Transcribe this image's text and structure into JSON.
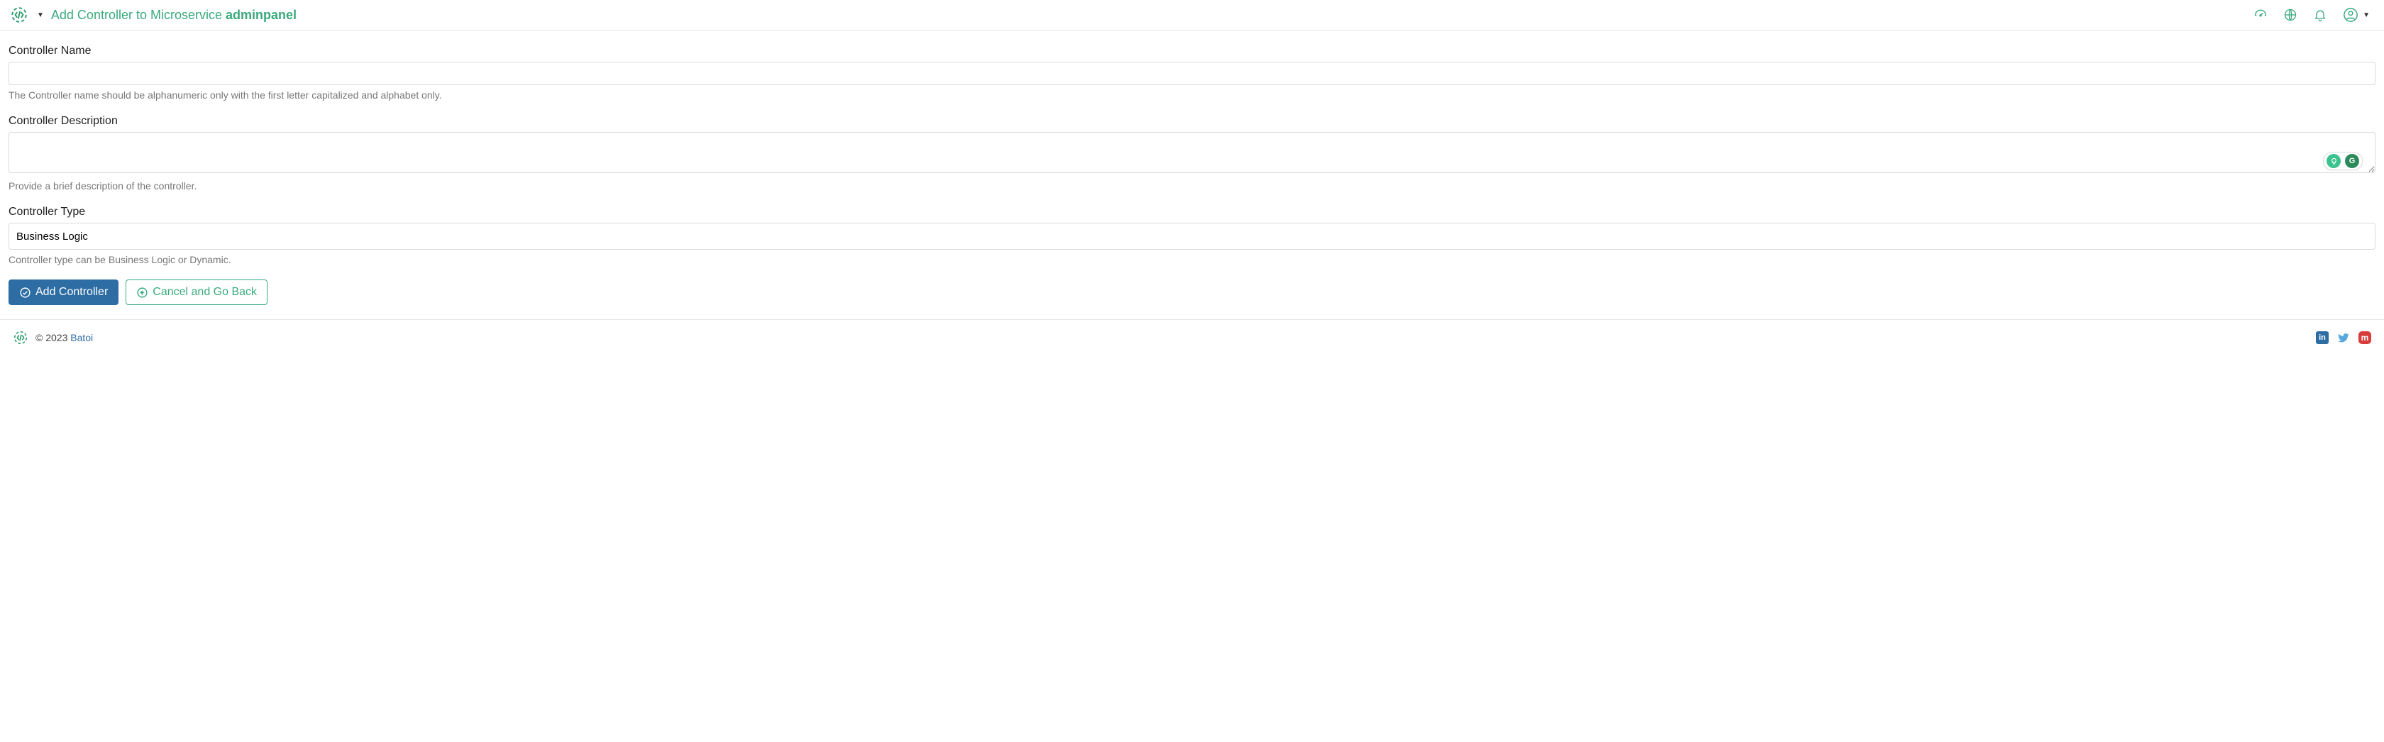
{
  "header": {
    "title_prefix": "Add Controller to Microservice ",
    "title_strong": "adminpanel"
  },
  "form": {
    "name": {
      "label": "Controller Name",
      "value": "",
      "help": "The Controller name should be alphanumeric only with the first letter capitalized and alphabet only."
    },
    "description": {
      "label": "Controller Description",
      "value": "",
      "help": "Provide a brief description of the controller."
    },
    "type": {
      "label": "Controller Type",
      "selected": "Business Logic",
      "help": "Controller type can be Business Logic or Dynamic."
    }
  },
  "buttons": {
    "submit": "Add Controller",
    "cancel": "Cancel and Go Back"
  },
  "overlay": {
    "letter": "G"
  },
  "footer": {
    "copyright": "© 2023 ",
    "brand": "Batoi",
    "social": {
      "linkedin": "in",
      "mastodon": "m"
    }
  }
}
